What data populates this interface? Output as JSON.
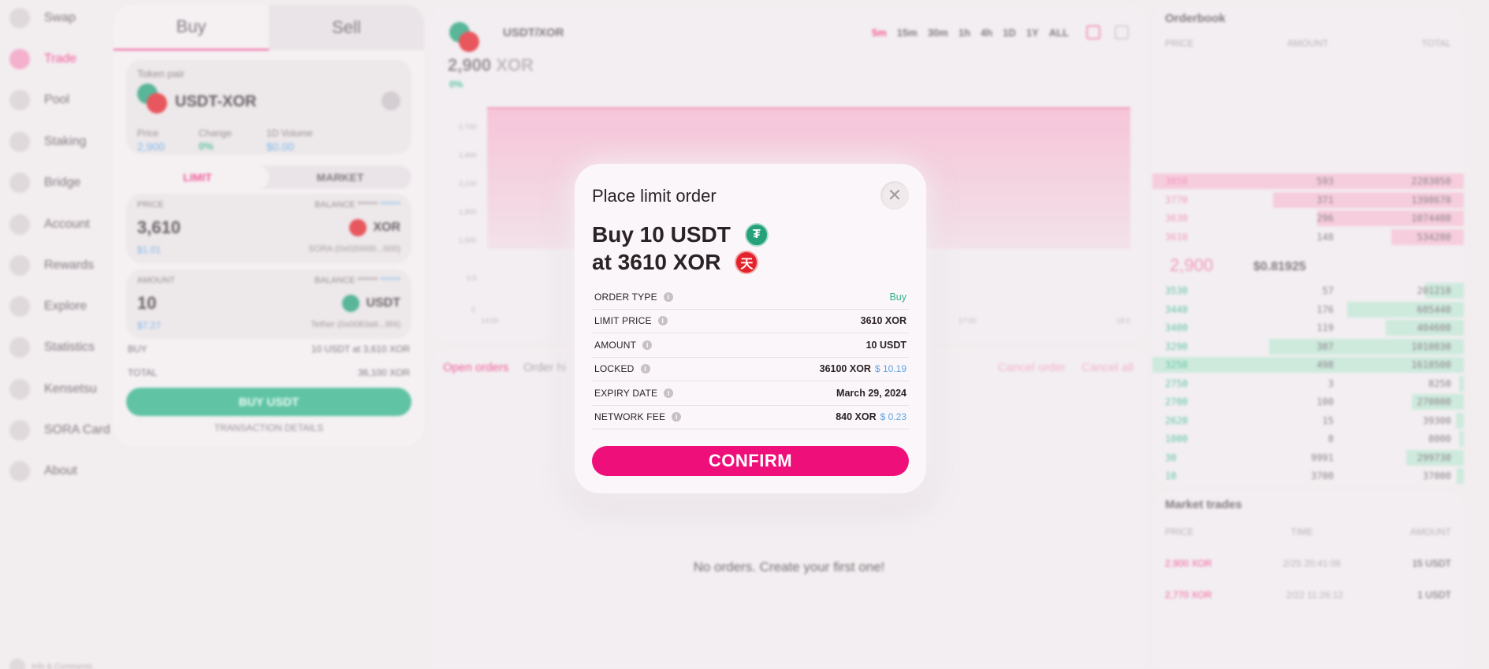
{
  "sidebar": {
    "items": [
      {
        "label": "Swap"
      },
      {
        "label": "Trade"
      },
      {
        "label": "Pool"
      },
      {
        "label": "Staking"
      },
      {
        "label": "Bridge"
      },
      {
        "label": "Account"
      },
      {
        "label": "Rewards"
      },
      {
        "label": "Explore"
      },
      {
        "label": "Statistics"
      },
      {
        "label": "Kensetsu"
      },
      {
        "label": "SORA Card"
      },
      {
        "label": "About"
      }
    ],
    "info_link": "Info & Comments"
  },
  "trade": {
    "tab_buy": "Buy",
    "tab_sell": "Sell",
    "token_pair_label": "Token pair",
    "pair": "USDT-XOR",
    "price_label": "Price",
    "price_value": "2,900",
    "change_label": "Change",
    "change_value": "0%",
    "volume_label": "1D Volume",
    "volume_value": "$0.00",
    "limit_label": "LIMIT",
    "market_label": "MARKET",
    "price_field_label": "PRICE",
    "balance_label": "BALANCE",
    "balance_mask": "******",
    "balance_mask_usd": "******",
    "price_input": "3,610",
    "price_usd": "$1.01",
    "price_token": "XOR",
    "price_token_address": "SORA (0x020000...000)",
    "amount_field_label": "AMOUNT",
    "amount_input": "10",
    "amount_usd": "$7.27",
    "amount_token": "USDT",
    "amount_token_address": "Tether (0x0083a6...6f4)",
    "buy_label": "BUY",
    "buy_summary": "10 USDT at 3,610 XOR",
    "total_label": "TOTAL",
    "total_value": "36,100 XOR",
    "buy_button": "BUY USDT",
    "tx_details": "TRANSACTION DETAILS"
  },
  "chart": {
    "pair": "USDT/XOR",
    "price": "2,900",
    "price_unit": "XOR",
    "change": "0%",
    "timeframes": [
      "5m",
      "15m",
      "30m",
      "1h",
      "4h",
      "1D",
      "1Y",
      "ALL"
    ],
    "y_ticks": [
      "2,700",
      "2,400",
      "2,100",
      "1,800",
      "1,500",
      "0.5",
      "0"
    ],
    "x_ticks": [
      "14:00",
      "17:00",
      "18:0"
    ]
  },
  "orders": {
    "tab_open": "Open orders",
    "tab_history": "Order hi",
    "cancel_order": "Cancel order",
    "cancel_all": "Cancel all",
    "empty": "No orders. Create your first one!"
  },
  "orderbook": {
    "title": "Orderbook",
    "col_price": "PRICE",
    "col_amount": "AMOUNT",
    "col_total": "TOTAL",
    "asks": [
      {
        "price": "3850",
        "amount": "593",
        "total": "2283050"
      },
      {
        "price": "3770",
        "amount": "371",
        "total": "1398670"
      },
      {
        "price": "3630",
        "amount": "296",
        "total": "1074480"
      },
      {
        "price": "3610",
        "amount": "148",
        "total": "534280"
      }
    ],
    "last_price": "2,900",
    "last_usd": "$0.81925",
    "bids": [
      {
        "price": "3530",
        "amount": "57",
        "total": "201210"
      },
      {
        "price": "3440",
        "amount": "176",
        "total": "605440"
      },
      {
        "price": "3400",
        "amount": "119",
        "total": "404600"
      },
      {
        "price": "3290",
        "amount": "307",
        "total": "1010030"
      },
      {
        "price": "3250",
        "amount": "498",
        "total": "1618500"
      },
      {
        "price": "2750",
        "amount": "3",
        "total": "8250"
      },
      {
        "price": "2700",
        "amount": "100",
        "total": "270000"
      },
      {
        "price": "2620",
        "amount": "15",
        "total": "39300"
      },
      {
        "price": "1000",
        "amount": "8",
        "total": "8000"
      },
      {
        "price": "30",
        "amount": "9991",
        "total": "299730"
      },
      {
        "price": "10",
        "amount": "3700",
        "total": "37000"
      }
    ]
  },
  "market_trades": {
    "title": "Market trades",
    "col_price": "PRICE",
    "col_time": "TIME",
    "col_amount": "AMOUNT",
    "rows": [
      {
        "price": "2,900 XOR",
        "time": "2/25 20:41:06",
        "amount": "15 USDT"
      },
      {
        "price": "2,770 XOR",
        "time": "2/22 11:26:12",
        "amount": "1 USDT"
      }
    ]
  },
  "dialog": {
    "title": "Place limit order",
    "close_glyph": "✕",
    "headline_1": "Buy 10 USDT",
    "headline_2": "at 3610 XOR",
    "usdt_glyph": "₮",
    "xor_glyph": "天",
    "rows": [
      {
        "label": "ORDER TYPE",
        "value": "Buy",
        "usd": ""
      },
      {
        "label": "LIMIT PRICE",
        "value": "3610 XOR",
        "usd": ""
      },
      {
        "label": "AMOUNT",
        "value": "10 USDT",
        "usd": ""
      },
      {
        "label": "LOCKED",
        "value": "36100 XOR",
        "usd": "$ 10.19"
      },
      {
        "label": "EXPIRY DATE",
        "value": "March 29, 2024",
        "usd": ""
      },
      {
        "label": "NETWORK FEE",
        "value": "840 XOR",
        "usd": "$ 0.23"
      }
    ],
    "info_glyph": "i",
    "confirm_button": "CONFIRM"
  },
  "colors": {
    "accent": "#ee0f7a",
    "buy_green": "#2fb389",
    "usd_blue": "#5aa5e6",
    "usdt": "#26a17b",
    "xor": "#e3232c"
  }
}
